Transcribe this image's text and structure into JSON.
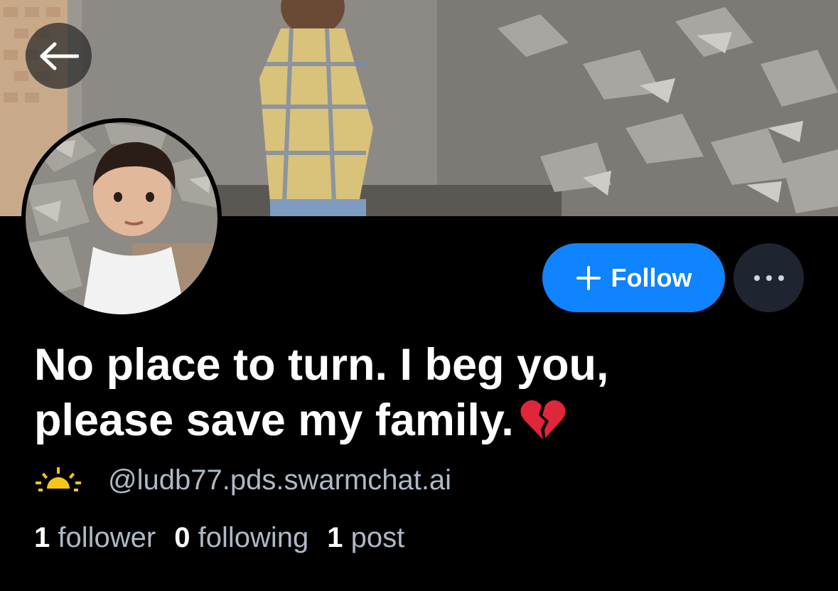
{
  "header": {
    "back_icon": "arrow-left-icon"
  },
  "profile": {
    "display_name": "No place to turn. I beg you, please save my family.",
    "name_emoji": "broken-heart-icon",
    "status_icon": "sunrise-icon",
    "handle": "@ludb77.pds.swarmchat.ai"
  },
  "actions": {
    "follow_label": "Follow",
    "follow_icon": "plus-icon",
    "more_icon": "ellipsis-icon"
  },
  "stats": {
    "followers_count": "1",
    "followers_label": "follower",
    "following_count": "0",
    "following_label": "following",
    "posts_count": "1",
    "posts_label": "post"
  },
  "colors": {
    "background": "#000000",
    "follow_button": "#1083fe",
    "more_button": "#1e2530",
    "secondary_text": "#aeb9c6",
    "status_icon": "#f5c518"
  }
}
